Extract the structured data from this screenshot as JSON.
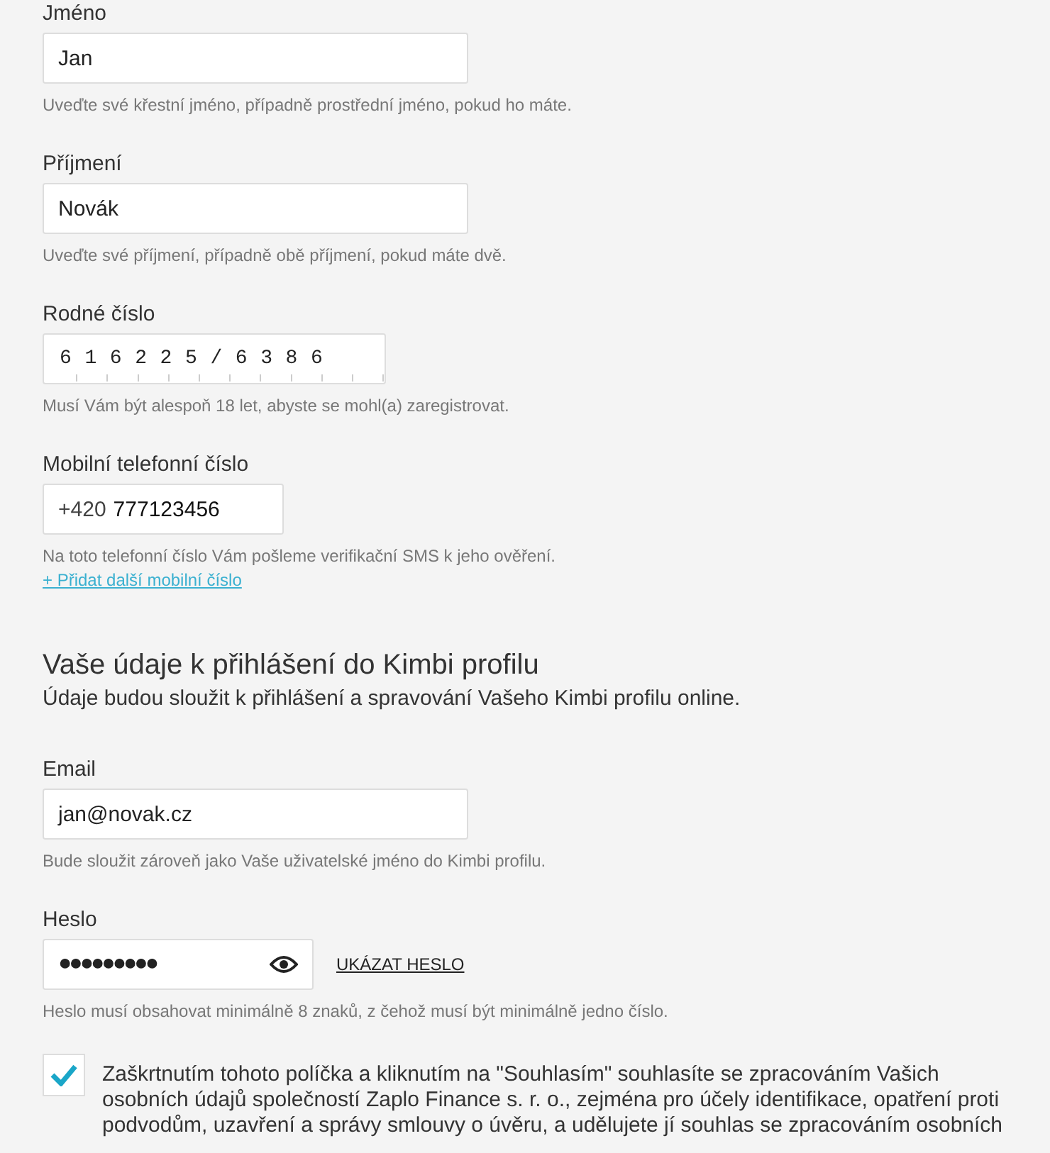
{
  "personal_fields": [
    {
      "kind": "text",
      "label": "Jméno",
      "value": "Jan",
      "hint": "Uveďte své křestní jméno, případně prostřední jméno, pokud ho máte."
    },
    {
      "kind": "text",
      "label": "Příjmení",
      "value": "Novák",
      "hint": "Uveďte své příjmení, případně obě příjmení, pokud máte dvě."
    },
    {
      "kind": "digits",
      "label": "Rodné číslo",
      "value": "616225/6386",
      "hint": "Musí Vám být alespoň 18 let, abyste se mohl(a) zaregistrovat."
    },
    {
      "kind": "phone",
      "label": "Mobilní telefonní číslo",
      "prefix": "+420",
      "value": "777123456",
      "hint": "Na toto telefonní číslo Vám pošleme verifikační SMS k jeho ověření.",
      "link": "+ Přidat další mobilní číslo"
    }
  ],
  "login_section": {
    "title": "Vaše údaje k přihlášení do Kimbi profilu",
    "subtitle": "Údaje budou sloužit k přihlášení a spravování Vašeho Kimbi profilu online.",
    "fields": [
      {
        "kind": "text",
        "label": "Email",
        "value": "jan@novak.cz",
        "hint": "Bude sloužit zároveň jako Vaše uživatelské jméno do Kimbi profilu."
      },
      {
        "kind": "password",
        "label": "Heslo",
        "value": "●●●●●●●●●",
        "show_link": "UKÁZAT HESLO",
        "hint": "Heslo musí obsahovat minimálně 8 znaků, z čehož musí být minimálně jedno číslo."
      }
    ]
  },
  "consent": {
    "checked": true,
    "text": "Zaškrtnutím tohoto políčka a kliknutím na \"Souhlasím\" souhlasíte se zpracováním Vašich\nosobních údajů společností Zaplo Finance s. r. o., zejména pro účely identifikace, opatření proti\npodvodům, uzavření a správy smlouvy o úvěru, a udělujete jí souhlas se zpracováním osobních"
  }
}
